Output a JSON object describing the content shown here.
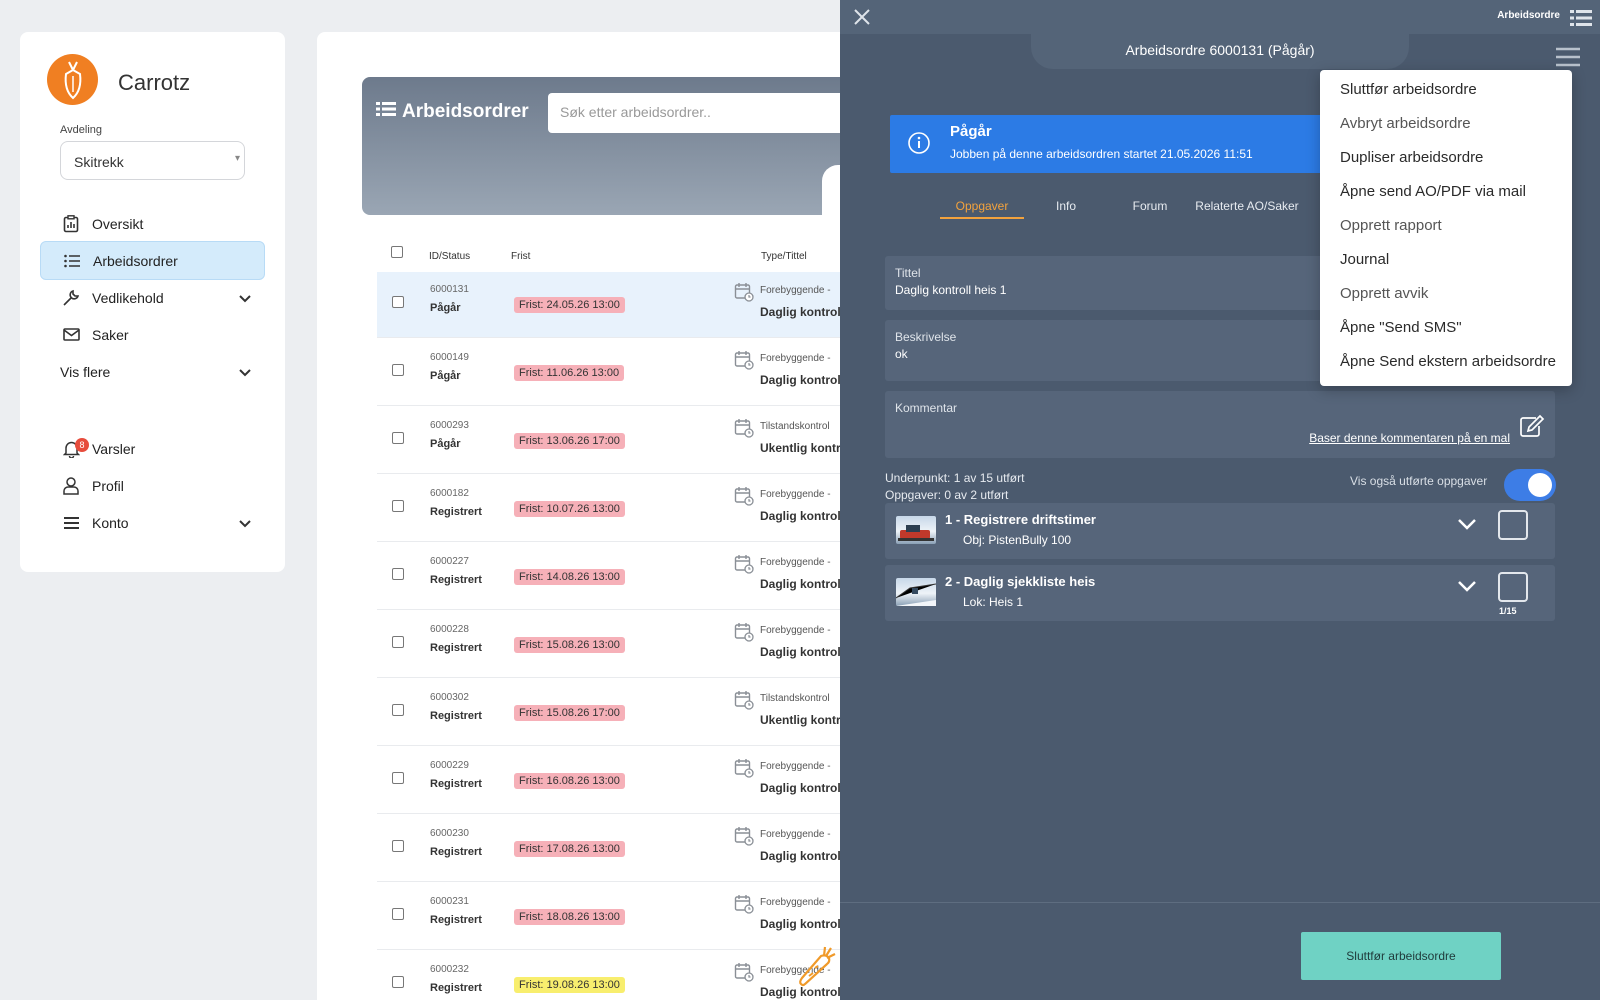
{
  "sidebar": {
    "brand": "Carrotz",
    "dept_label": "Avdeling",
    "dept_value": "Skitrekk",
    "nav": [
      {
        "label": "Oversikt",
        "icon": "clipboard-chart-icon"
      },
      {
        "label": "Arbeidsordrer",
        "icon": "list-icon",
        "active": true
      },
      {
        "label": "Vedlikehold",
        "icon": "wrench-icon",
        "dropdown": true
      },
      {
        "label": "Saker",
        "icon": "mail-icon"
      },
      {
        "label": "Vis flere",
        "dropdown": true
      }
    ],
    "nav2": [
      {
        "label": "Varsler",
        "icon": "bell-icon",
        "badge": "8"
      },
      {
        "label": "Profil",
        "icon": "user-icon"
      },
      {
        "label": "Konto",
        "icon": "menu-icon",
        "dropdown": true
      }
    ]
  },
  "list": {
    "title": "Arbeidsordrer",
    "search_placeholder": "Søk etter arbeidsordrer..",
    "columns": [
      "ID/Status",
      "Frist",
      "Type/Tittel"
    ],
    "rows": [
      {
        "id": "6000131",
        "status": "Pågår",
        "due": "Frist: 24.05.26 13:00",
        "type": "Forebyggende -",
        "title": "Daglig kontroll",
        "selected": true
      },
      {
        "id": "6000149",
        "status": "Pågår",
        "due": "Frist: 11.06.26 13:00",
        "type": "Forebyggende -",
        "title": "Daglig kontroll"
      },
      {
        "id": "6000293",
        "status": "Pågår",
        "due": "Frist: 13.06.26 17:00",
        "type": "Tilstandskontrol",
        "title": "Ukentlig kontro"
      },
      {
        "id": "6000182",
        "status": "Registrert",
        "due": "Frist: 10.07.26 13:00",
        "type": "Forebyggende -",
        "title": "Daglig kontroll"
      },
      {
        "id": "6000227",
        "status": "Registrert",
        "due": "Frist: 14.08.26 13:00",
        "type": "Forebyggende -",
        "title": "Daglig kontroll"
      },
      {
        "id": "6000228",
        "status": "Registrert",
        "due": "Frist: 15.08.26 13:00",
        "type": "Forebyggende -",
        "title": "Daglig kontroll"
      },
      {
        "id": "6000302",
        "status": "Registrert",
        "due": "Frist: 15.08.26 17:00",
        "type": "Tilstandskontrol",
        "title": "Ukentlig kontro"
      },
      {
        "id": "6000229",
        "status": "Registrert",
        "due": "Frist: 16.08.26 13:00",
        "type": "Forebyggende -",
        "title": "Daglig kontroll"
      },
      {
        "id": "6000230",
        "status": "Registrert",
        "due": "Frist: 17.08.26 13:00",
        "type": "Forebyggende -",
        "title": "Daglig kontroll"
      },
      {
        "id": "6000231",
        "status": "Registrert",
        "due": "Frist: 18.08.26 13:00",
        "type": "Forebyggende -",
        "title": "Daglig kontroll"
      },
      {
        "id": "6000232",
        "status": "Registrert",
        "due": "Frist: 19.08.26 13:00",
        "type": "Forebyggende -",
        "title": "Daglig kontroll",
        "due_color": "yellow"
      }
    ]
  },
  "panel": {
    "topbar_label": "Arbeidsordre",
    "title": "Arbeidsordre 6000131 (Pågår)",
    "info_heading": "Pågår",
    "info_text": "Jobben på denne arbeidsordren startet 21.05.2026 11:51",
    "tabs": [
      "Oppgaver",
      "Info",
      "Forum",
      "Relaterte AO/Saker"
    ],
    "fields": {
      "title_label": "Tittel",
      "title_value": "Daglig kontroll heis 1",
      "desc_label": "Beskrivelse",
      "desc_value": "ok",
      "comment_label": "Kommentar",
      "template_link": "Baser denne kommentaren på en mal"
    },
    "subpoint_count": "Underpunkt: 1 av 15 utført",
    "task_count": "Oppgaver: 0 av 2 utført",
    "show_done_label": "Vis også utførte oppgaver",
    "show_done_on": true,
    "tasks": [
      {
        "heading": "1 - Registrere driftstimer",
        "sub": "Obj: PistenBully 100",
        "count": ""
      },
      {
        "heading": "2 - Daglig sjekkliste heis",
        "sub": "Lok: Heis 1",
        "count": "1/15"
      }
    ],
    "finish_button": "Sluttfør arbeidsordre"
  },
  "menu": {
    "items": [
      {
        "label": "Sluttfør arbeidsordre"
      },
      {
        "label": "Avbryt arbeidsordre",
        "muted": true
      },
      {
        "label": "Dupliser arbeidsordre"
      },
      {
        "label": "Åpne send AO/PDF via mail"
      },
      {
        "label": "Opprett rapport",
        "muted": true
      },
      {
        "label": "Journal"
      },
      {
        "label": "Opprett avvik",
        "muted": true
      },
      {
        "label": "Åpne \"Send SMS\""
      },
      {
        "label": "Åpne Send ekstern arbeidsordre"
      }
    ]
  },
  "colors": {
    "accent": "#2c7be5",
    "brand": "#f07f22",
    "panel_bg": "#4b5a6e",
    "tab_active": "#f2a23d",
    "finish": "#6fd2c4"
  }
}
